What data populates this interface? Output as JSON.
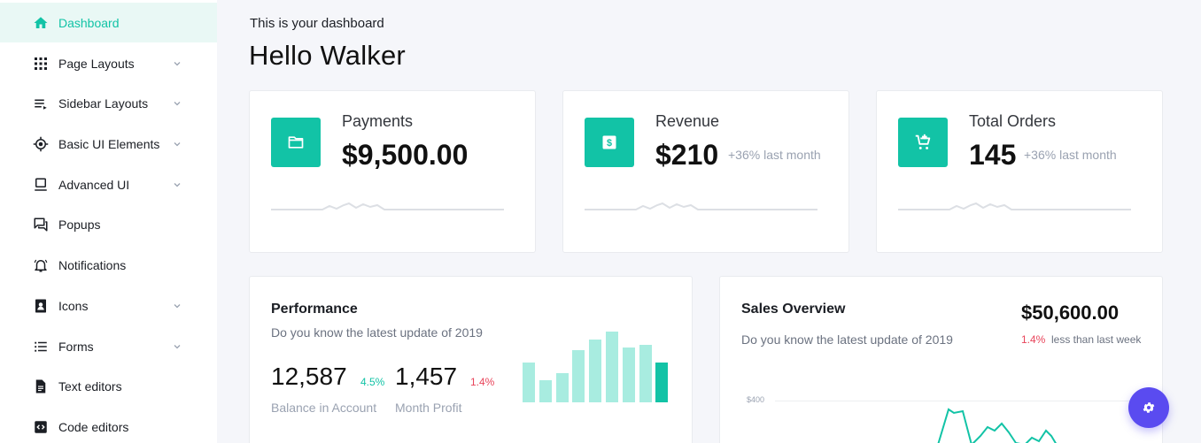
{
  "sidebar": {
    "items": [
      {
        "label": "Dashboard",
        "icon": "home-icon",
        "active": true,
        "has_chevron": false
      },
      {
        "label": "Page Layouts",
        "icon": "grid-icon",
        "has_chevron": true
      },
      {
        "label": "Sidebar Layouts",
        "icon": "sidebar-list-icon",
        "has_chevron": true
      },
      {
        "label": "Basic UI Elements",
        "icon": "target-icon",
        "has_chevron": true
      },
      {
        "label": "Advanced UI",
        "icon": "laptop-icon",
        "has_chevron": true
      },
      {
        "label": "Popups",
        "icon": "chat-icon",
        "has_chevron": false
      },
      {
        "label": "Notifications",
        "icon": "bell-icon",
        "has_chevron": false
      },
      {
        "label": "Icons",
        "icon": "contact-card-icon",
        "has_chevron": true
      },
      {
        "label": "Forms",
        "icon": "list-icon",
        "has_chevron": true
      },
      {
        "label": "Text editors",
        "icon": "document-icon",
        "has_chevron": false
      },
      {
        "label": "Code editors",
        "icon": "code-icon",
        "has_chevron": false
      }
    ]
  },
  "header": {
    "subtitle": "This is your dashboard",
    "title": "Hello Walker"
  },
  "stats": [
    {
      "label": "Payments",
      "value": "$9,500.00",
      "note": "",
      "icon": "folder-icon"
    },
    {
      "label": "Revenue",
      "value": "$210",
      "note": "+36% last month",
      "icon": "dollar-icon"
    },
    {
      "label": "Total Orders",
      "value": "145",
      "note": "+36% last month",
      "icon": "cart-add-icon"
    }
  ],
  "performance": {
    "title": "Performance",
    "subtitle": "Do you know the latest update of 2019",
    "balance": {
      "value": "12,587",
      "pct": "4.5%",
      "label": "Balance in Account"
    },
    "profit": {
      "value": "1,457",
      "pct": "1.4%",
      "label": "Month Profit"
    },
    "bars": [
      0.55,
      0.3,
      0.4,
      0.72,
      0.87,
      0.97,
      0.75,
      0.79,
      0.55
    ]
  },
  "sales": {
    "title": "Sales Overview",
    "subtitle": "Do you know the latest update of 2019",
    "amount": "$50,600.00",
    "pct": "1.4%",
    "note": "less than last week",
    "y_tick": "$400"
  },
  "colors": {
    "accent": "#12c3a6",
    "accent_light": "#a8ece0",
    "negative": "#e8445a",
    "fab": "#5a4bf0"
  },
  "fab": {
    "icon": "settings-gear-icon"
  }
}
